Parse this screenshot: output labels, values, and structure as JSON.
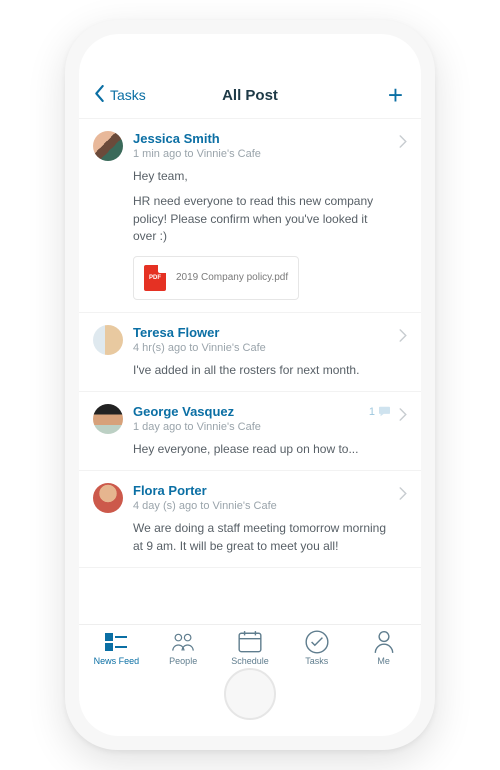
{
  "header": {
    "back_label": "Tasks",
    "title": "All Post",
    "add_label": "+"
  },
  "posts": [
    {
      "author": "Jessica Smith",
      "meta": "1 min ago to Vinnie's Cafe",
      "body_p1": "Hey team,",
      "body_p2": "HR need everyone to read this new company policy! Please confirm when you've looked it over :)",
      "attachment": {
        "type_label": "PDF",
        "filename": "2019 Company policy.pdf"
      }
    },
    {
      "author": "Teresa Flower",
      "meta": "4 hr(s) ago to Vinnie's Cafe",
      "body_p1": "I've added in all the rosters for next month."
    },
    {
      "author": "George Vasquez",
      "meta": "1 day ago to Vinnie's Cafe",
      "body_p1": "Hey everyone, please read up on how to...",
      "comments": "1"
    },
    {
      "author": "Flora Porter",
      "meta": "4 day (s) ago to Vinnie's Cafe",
      "body_p1": "We are doing a staff meeting tomorrow morning at 9 am. It will be great to meet you all!"
    }
  ],
  "tabs": {
    "newsfeed": "News Feed",
    "people": "People",
    "schedule": "Schedule",
    "tasks": "Tasks",
    "me": "Me"
  }
}
